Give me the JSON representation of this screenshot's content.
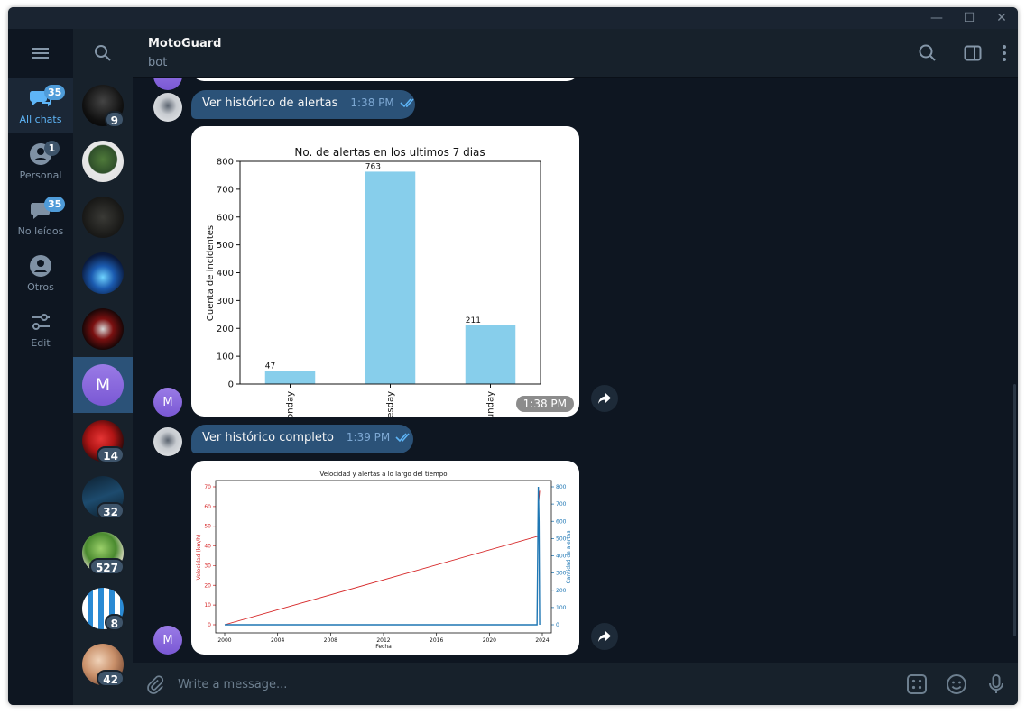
{
  "window": {
    "min_glyph": "—",
    "max_glyph": "☐",
    "close_glyph": "✕"
  },
  "folders": [
    {
      "label": "All chats",
      "badge": "35",
      "icon": "chat-bubbles-icon",
      "active": true
    },
    {
      "label": "Personal",
      "badge": "1",
      "icon": "person-icon",
      "active": false
    },
    {
      "label": "No leídos",
      "badge": "35",
      "icon": "chat-bubble-icon",
      "active": false
    },
    {
      "label": "Otros",
      "badge": "",
      "icon": "person-circle-icon",
      "active": false
    },
    {
      "label": "Edit",
      "badge": "",
      "icon": "sliders-icon",
      "active": false
    }
  ],
  "chats": [
    {
      "badge": "9"
    },
    {
      "badge": ""
    },
    {
      "badge": ""
    },
    {
      "badge": ""
    },
    {
      "badge": ""
    },
    {
      "badge": "",
      "letter": "M",
      "active": true
    },
    {
      "badge": "14"
    },
    {
      "badge": "32"
    },
    {
      "badge": "527"
    },
    {
      "badge": "8"
    },
    {
      "badge": "42"
    }
  ],
  "header": {
    "title": "MotoGuard",
    "subtitle": "bot"
  },
  "avatar_letter": "M",
  "messages": [
    {
      "type": "outgoing_text",
      "text": "Ver histórico de alertas",
      "time": "1:38 PM"
    },
    {
      "type": "incoming_photo",
      "time": "1:38 PM"
    },
    {
      "type": "outgoing_text",
      "text": "Ver histórico completo",
      "time": "1:39 PM"
    },
    {
      "type": "incoming_photo",
      "time": ""
    }
  ],
  "composer": {
    "placeholder": "Write a message..."
  },
  "chart_data": [
    {
      "type": "bar",
      "title": "No. de alertas en los ultimos 7 dias",
      "ylabel": "Cuenta de incidentes",
      "xlabel": "",
      "categories": [
        "Monday",
        "Wednesday",
        "Sunday"
      ],
      "visible_tick_text": [
        "onday",
        "esday",
        "unday"
      ],
      "values": [
        47,
        763,
        211
      ],
      "ylim": [
        0,
        800
      ],
      "yticks": [
        "0",
        "100",
        "200",
        "300",
        "400",
        "500",
        "600",
        "700",
        "800"
      ],
      "color": "#87ceeb"
    },
    {
      "type": "line",
      "title": "Velocidad y alertas a lo largo del tiempo",
      "xlabel": "Fecha",
      "ylabel": "Velocidad (km/h)",
      "y2label": "Cantidad de alertas",
      "xlim": [
        2000,
        2024
      ],
      "ylim": [
        0,
        70
      ],
      "y2lim": [
        0,
        800
      ],
      "xticks": [
        "2000",
        "2004",
        "2008",
        "2012",
        "2016",
        "2020",
        "2024"
      ],
      "yticks": [
        "0",
        "10",
        "20",
        "30",
        "40",
        "50",
        "60",
        "70"
      ],
      "y2ticks": [
        "0",
        "100",
        "200",
        "300",
        "400",
        "500",
        "600",
        "700",
        "800"
      ],
      "series": [
        {
          "axis": "left",
          "color": "#d62728",
          "x": [
            2000,
            2023.7,
            2023.7,
            2023.8
          ],
          "y": [
            0,
            45,
            60,
            68
          ]
        },
        {
          "axis": "right",
          "color": "#1f77b4",
          "x": [
            2000,
            2023.6,
            2023.7,
            2023.75,
            2023.8
          ],
          "y": [
            0,
            0,
            800,
            600,
            0
          ]
        }
      ]
    }
  ]
}
